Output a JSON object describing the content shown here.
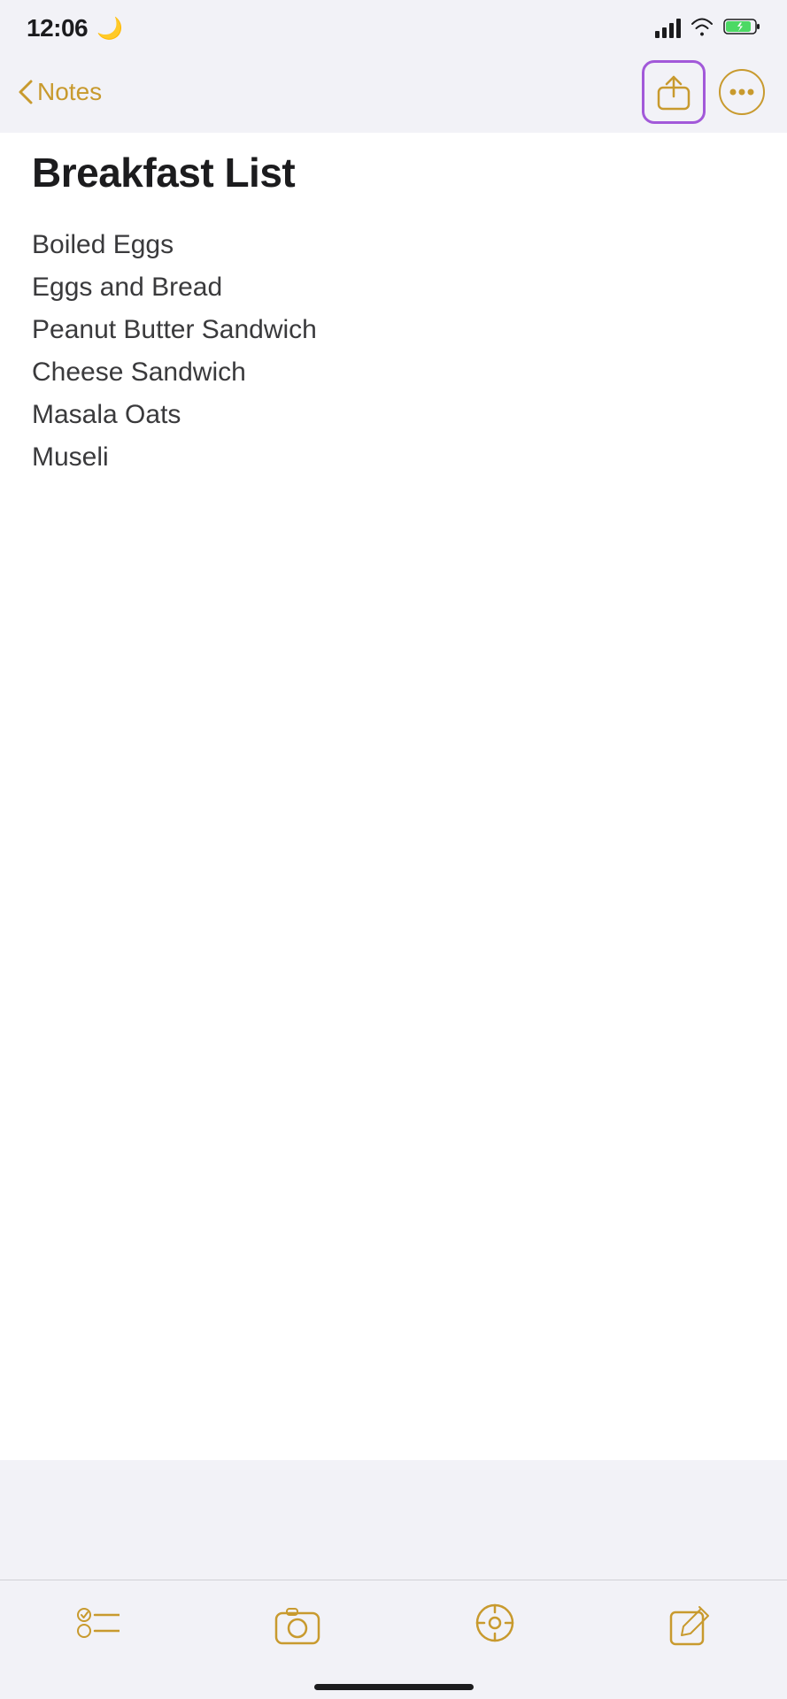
{
  "statusBar": {
    "time": "12:06",
    "moonIcon": "🌙"
  },
  "navBar": {
    "backLabel": "Notes",
    "shareIconLabel": "share-icon",
    "moreIconLabel": "more-icon"
  },
  "note": {
    "title": "Breakfast List",
    "items": [
      "Boiled Eggs",
      "Eggs and Bread",
      "Peanut Butter Sandwich",
      "Cheese Sandwich",
      "Masala Oats",
      "Museli"
    ]
  },
  "toolbar": {
    "checklistLabel": "checklist",
    "cameraLabel": "camera",
    "locationLabel": "location",
    "composeLabel": "compose"
  },
  "colors": {
    "accent": "#c89a2e",
    "highlight": "#a259d9",
    "text": "#1c1c1e",
    "subtext": "#3a3a3c"
  }
}
